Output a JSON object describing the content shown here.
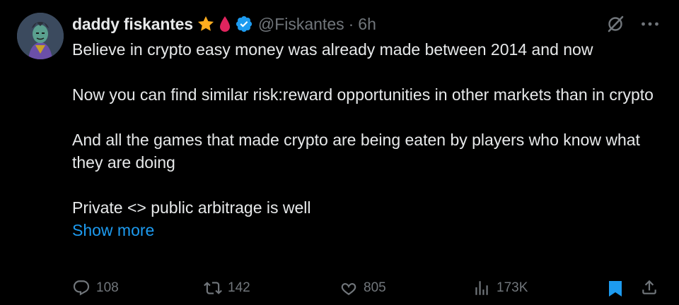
{
  "author": {
    "display_name": "daddy fiskantes",
    "handle": "@Fiskantes",
    "separator": "·",
    "time": "6h",
    "badges": [
      "star-icon",
      "blood-drop-icon",
      "verified-icon"
    ]
  },
  "tweet": {
    "paragraphs": [
      "Believe in crypto easy money was already made between 2014 and now",
      "Now you can find similar risk:reward opportunities in other markets than in crypto",
      "And all the games that made crypto are being eaten by players who know what they are doing",
      "Private <> public arbitrage is well"
    ],
    "show_more": "Show more"
  },
  "actions": {
    "replies": "108",
    "reposts": "142",
    "likes": "805",
    "views": "173K"
  },
  "colors": {
    "background": "#000000",
    "text": "#e7e9ea",
    "muted": "#71767b",
    "link": "#1d9bf0",
    "verified": "#1d9bf0",
    "star": "#ffad1f",
    "drop": "#e0245e"
  }
}
